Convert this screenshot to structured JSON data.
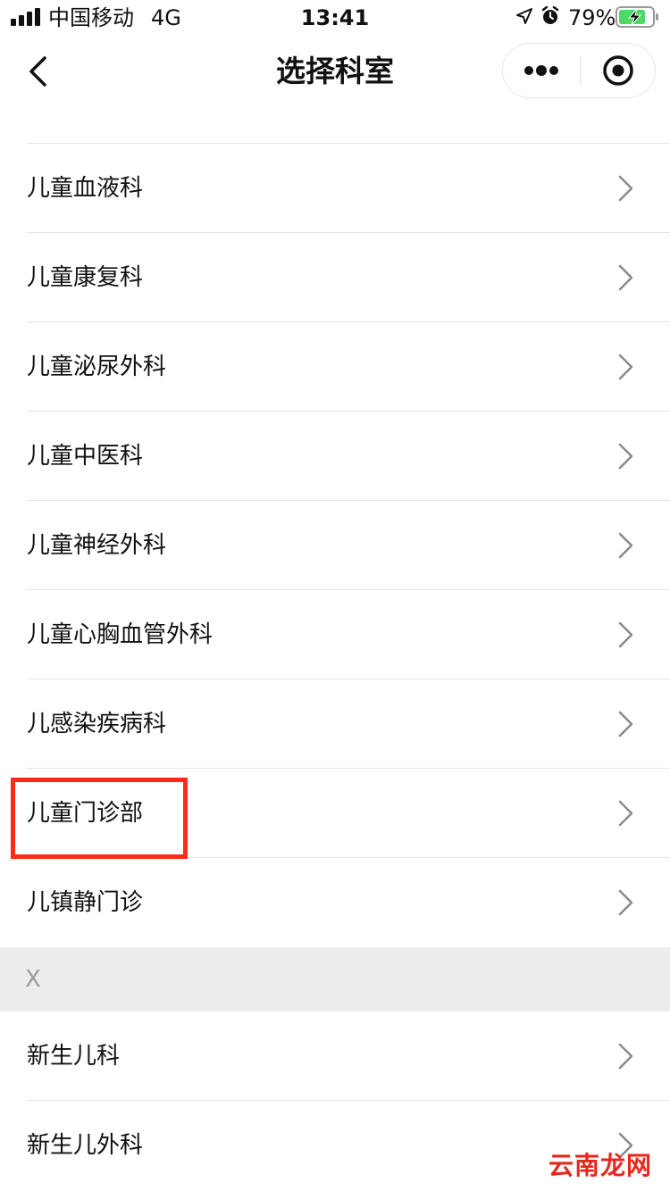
{
  "status_bar": {
    "carrier": "中国移动",
    "network": "4G",
    "time": "13:41",
    "battery_percent": "79%",
    "icons": [
      "signal-icon",
      "location-icon",
      "alarm-icon",
      "battery-charging-icon"
    ]
  },
  "nav": {
    "title": "选择科室",
    "back_icon": "chevron-left-icon",
    "more_icon": "more-dots-icon",
    "close_icon": "target-close-icon"
  },
  "departments_group_1": [
    {
      "label": "儿童血液科"
    },
    {
      "label": "儿童康复科"
    },
    {
      "label": "儿童泌尿外科"
    },
    {
      "label": "儿童中医科"
    },
    {
      "label": "儿童神经外科"
    },
    {
      "label": "儿童心胸血管外科"
    },
    {
      "label": "儿感染疾病科"
    },
    {
      "label": "儿童门诊部",
      "highlighted": true
    },
    {
      "label": "儿镇静门诊"
    }
  ],
  "section_x": {
    "letter": "X"
  },
  "departments_group_2": [
    {
      "label": "新生儿科"
    },
    {
      "label": "新生儿外科"
    }
  ],
  "colors": {
    "highlight": "#ff2a1a",
    "section_bg": "#ededed",
    "divider": "#e5e5e5",
    "watermark": "#e8261b"
  },
  "watermark": "云南龙网"
}
